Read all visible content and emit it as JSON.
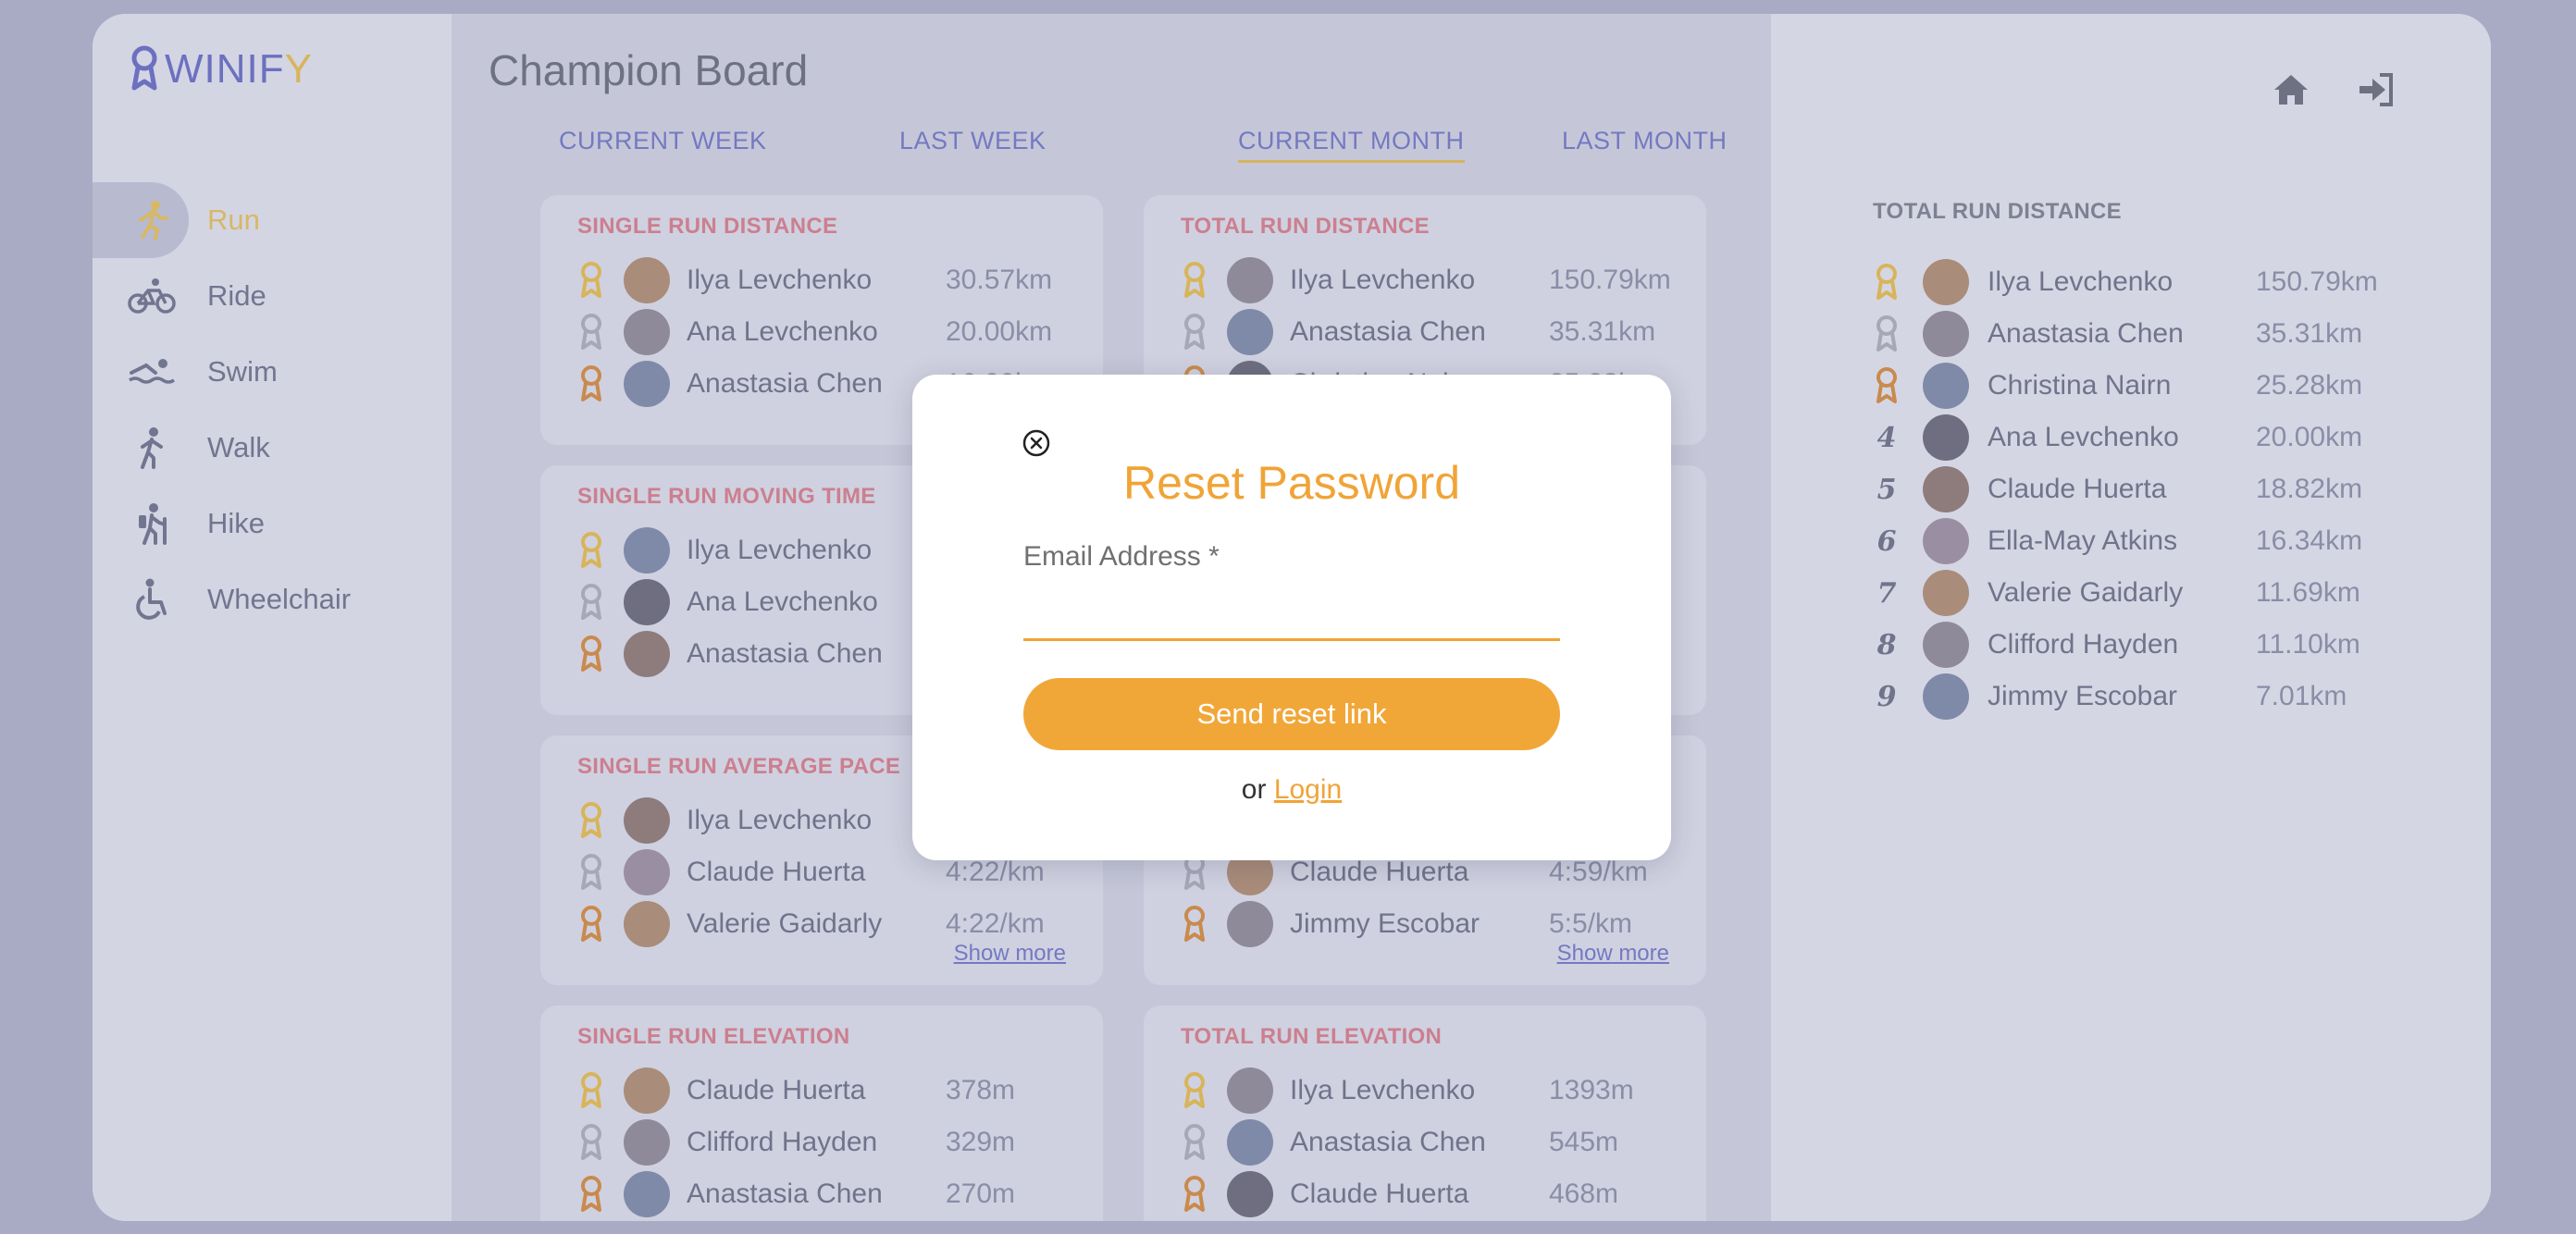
{
  "brand": {
    "logo_text_main": "WINIF",
    "logo_text_accent": "Y"
  },
  "sidebar": {
    "items": [
      {
        "label": "Run",
        "icon": "run-icon",
        "active": true
      },
      {
        "label": "Ride",
        "icon": "bike-icon"
      },
      {
        "label": "Swim",
        "icon": "swim-icon"
      },
      {
        "label": "Walk",
        "icon": "walk-icon"
      },
      {
        "label": "Hike",
        "icon": "hike-icon"
      },
      {
        "label": "Wheelchair",
        "icon": "wheelchair-icon"
      }
    ]
  },
  "main": {
    "title": "Champion Board",
    "tabs": [
      {
        "label": "CURRENT WEEK"
      },
      {
        "label": "LAST WEEK"
      },
      {
        "label": "CURRENT MONTH",
        "active": true
      },
      {
        "label": "LAST MONTH"
      }
    ],
    "cards": [
      {
        "title": "SINGLE RUN DISTANCE",
        "rows": [
          {
            "name": "Ilya Levchenko",
            "value": "30.57km"
          },
          {
            "name": "Ana Levchenko",
            "value": "20.00km"
          },
          {
            "name": "Anastasia Chen",
            "value": "16.00km"
          }
        ]
      },
      {
        "title": "TOTAL RUN DISTANCE",
        "rows": [
          {
            "name": "Ilya Levchenko",
            "value": "150.79km"
          },
          {
            "name": "Anastasia Chen",
            "value": "35.31km"
          },
          {
            "name": "Christina Nairn",
            "value": "25.28km"
          }
        ]
      },
      {
        "title": "SINGLE RUN MOVING TIME",
        "rows": [
          {
            "name": "Ilya Levchenko",
            "value": ""
          },
          {
            "name": "Ana Levchenko",
            "value": ""
          },
          {
            "name": "Anastasia Chen",
            "value": ""
          }
        ]
      },
      {
        "title": "",
        "rows": []
      },
      {
        "title": "SINGLE RUN AVERAGE PACE",
        "show_more": "Show more",
        "rows": [
          {
            "name": "Ilya Levchenko",
            "value": ""
          },
          {
            "name": "Claude Huerta",
            "value": "4:22/km"
          },
          {
            "name": "Valerie Gaidarly",
            "value": "4:22/km"
          }
        ]
      },
      {
        "title": "",
        "show_more": "Show more",
        "rows": [
          {
            "name": "",
            "value": ""
          },
          {
            "name": "Claude Huerta",
            "value": "4:59/km"
          },
          {
            "name": "Jimmy Escobar",
            "value": "5:5/km"
          }
        ]
      },
      {
        "title": "SINGLE RUN ELEVATION",
        "rows": [
          {
            "name": "Claude Huerta",
            "value": "378m"
          },
          {
            "name": "Clifford Hayden",
            "value": "329m"
          },
          {
            "name": "Anastasia Chen",
            "value": "270m"
          }
        ]
      },
      {
        "title": "TOTAL RUN ELEVATION",
        "rows": [
          {
            "name": "Ilya Levchenko",
            "value": "1393m"
          },
          {
            "name": "Anastasia Chen",
            "value": "545m"
          },
          {
            "name": "Claude Huerta",
            "value": "468m"
          }
        ]
      }
    ]
  },
  "header_icons": [
    "home-icon",
    "login-icon"
  ],
  "leaderboard": {
    "title": "TOTAL RUN DISTANCE",
    "rows": [
      {
        "rank": "1",
        "name": "Ilya Levchenko",
        "value": "150.79km"
      },
      {
        "rank": "2",
        "name": "Anastasia Chen",
        "value": "35.31km"
      },
      {
        "rank": "3",
        "name": "Christina Nairn",
        "value": "25.28km"
      },
      {
        "rank": "4",
        "name": "Ana Levchenko",
        "value": "20.00km"
      },
      {
        "rank": "5",
        "name": "Claude Huerta",
        "value": "18.82km"
      },
      {
        "rank": "6",
        "name": "Ella-May Atkins",
        "value": "16.34km"
      },
      {
        "rank": "7",
        "name": "Valerie Gaidarly",
        "value": "11.69km"
      },
      {
        "rank": "8",
        "name": "Clifford Hayden",
        "value": "11.10km"
      },
      {
        "rank": "9",
        "name": "Jimmy Escobar",
        "value": "7.01km"
      }
    ]
  },
  "modal": {
    "title": "Reset Password",
    "email_label": "Email Address *",
    "email_value": "",
    "send_button": "Send reset link",
    "or_text": "or",
    "login_link": "Login"
  },
  "colors": {
    "accent": "#f0a437",
    "gold": "#d8b45a",
    "silver": "#a6a8b8",
    "bronze": "#c98a4e",
    "link": "#7479c2"
  }
}
